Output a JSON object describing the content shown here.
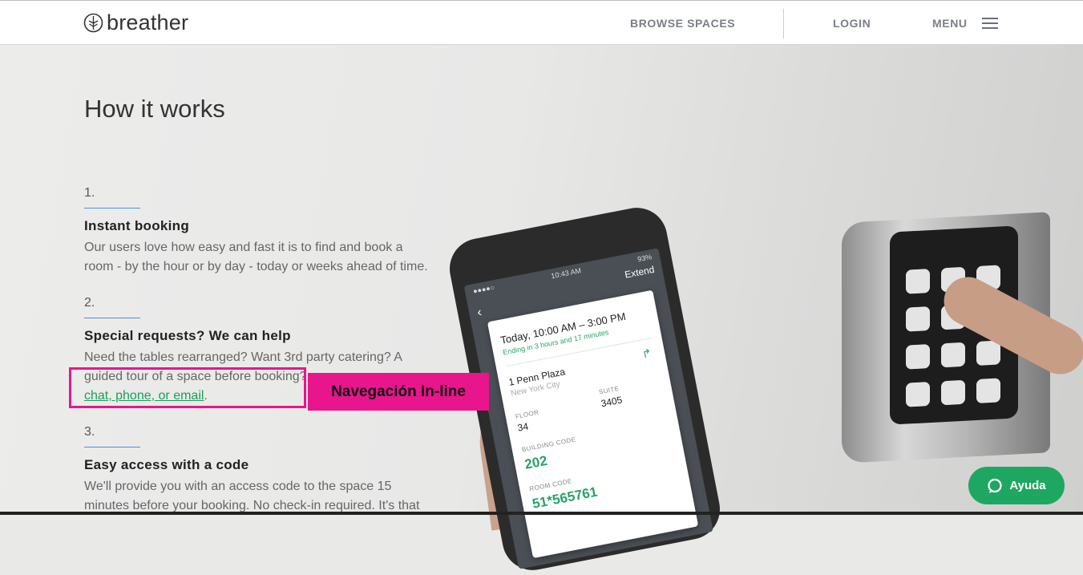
{
  "header": {
    "logo_text": "breather",
    "nav": {
      "browse": "BROWSE SPACES",
      "login": "LOGIN",
      "menu": "MENU"
    }
  },
  "main": {
    "title": "How it works",
    "steps": [
      {
        "number": "1.",
        "title": "Instant booking",
        "body_line1": "Our users love how easy and fast it is to find and book a",
        "body_line2": "room - by the hour or by day - today or weeks ahead of time."
      },
      {
        "number": "2.",
        "title": "Special requests? We can help",
        "body_line1": "Need the tables rearranged? Want 3rd party catering? A",
        "body_line2": "guided tour of a space before booking?",
        "link": "chat, phone, or email",
        "link_suffix": "."
      },
      {
        "number": "3.",
        "title": "Easy access with a code",
        "body_line1": "We'll provide you with an access code to the space 15",
        "body_line2": "minutes before your booking. No check-in required. It's that"
      }
    ]
  },
  "annotation": {
    "label": "Navegación In-line"
  },
  "phone": {
    "time": "10:43 AM",
    "battery": "93%",
    "extend": "Extend",
    "booking_time": "Today, 10:00 AM – 3:00 PM",
    "ending": "Ending in 3 hours and 17 minutes",
    "address": "1 Penn Plaza",
    "city": "New York City",
    "floor_label": "FLOOR",
    "floor": "34",
    "suite_label": "SUITE",
    "suite": "3405",
    "building_code_label": "BUILDING CODE",
    "building_code": "202",
    "room_code_label": "ROOM CODE",
    "room_code": "51*565761"
  },
  "help": {
    "label": "Ayuda"
  },
  "colors": {
    "accent_green": "#1ea760",
    "annotation_pink": "#e8158d",
    "link_green": "#1a9e5a"
  }
}
